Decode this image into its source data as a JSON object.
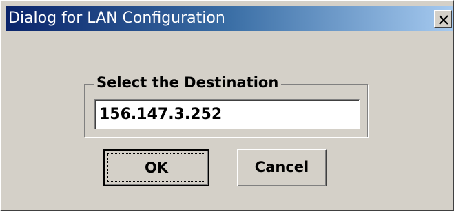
{
  "window": {
    "title": "Dialog for LAN Configuration",
    "close_icon": "close-icon"
  },
  "group": {
    "label": "Select the Destination"
  },
  "destination": {
    "value": "156.147.3.252"
  },
  "buttons": {
    "ok_label": "OK",
    "cancel_label": "Cancel"
  },
  "colors": {
    "face": "#d4d0c8",
    "title_start": "#0a246a",
    "title_end": "#a6caf0",
    "title_text": "#ffffff"
  }
}
